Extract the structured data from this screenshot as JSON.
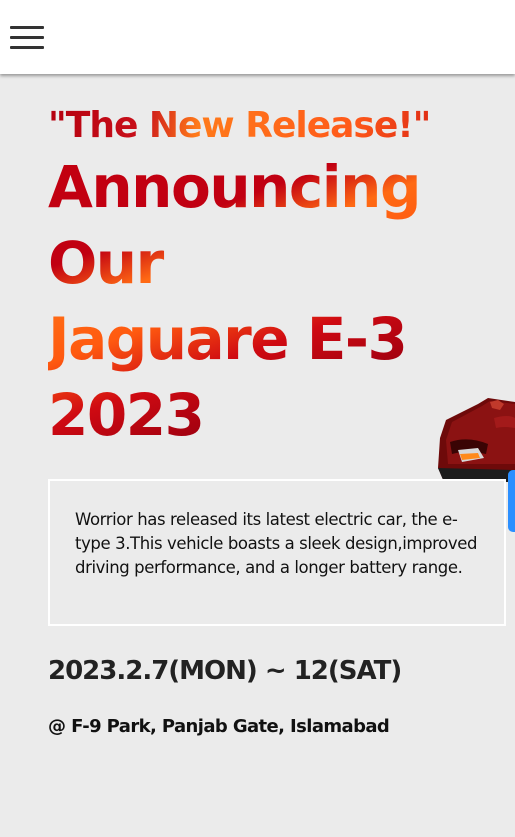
{
  "header": {
    "menu_icon": "hamburger-menu-icon"
  },
  "hero": {
    "tagline": "\"The New Release!\"",
    "headline_lines": [
      "Announcing",
      "Our",
      "Jaguare E-3",
      "2023"
    ]
  },
  "description": "Worrior has released its latest electric car, the e-type 3.This vehicle boasts a sleek design,improved driving performance, and a longer battery range.",
  "event": {
    "date": "2023.2.7(MON) ~ 12(SAT)",
    "venue": "@ F-9 Park, Panjab Gate, Islamabad"
  },
  "colors": {
    "background": "#ebebeb",
    "header_bg": "#ffffff",
    "accent_red": "#c30010",
    "accent_orange": "#ff6a14",
    "dark_red": "#620006",
    "scroll_tab": "#2b8fff"
  }
}
